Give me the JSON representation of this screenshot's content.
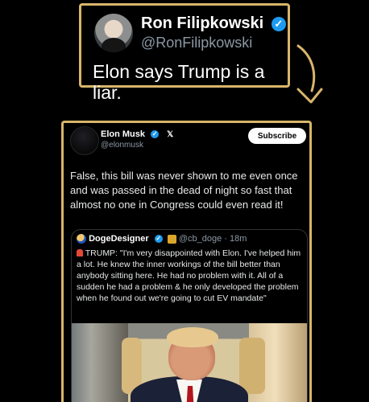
{
  "top_post": {
    "name": "Ron Filipkowski",
    "handle": "@RonFilipkowski",
    "text": "Elon says Trump is a liar.",
    "verified_icon": "verified-badge"
  },
  "main_post": {
    "name": "Elon Musk",
    "handle": "@elonmusk",
    "x_icon": "x-logo",
    "subscribe_label": "Subscribe",
    "text": "False, this bill was never shown to me even once and was passed in the dead of night so fast that almost no one in Congress could even read it!"
  },
  "quoted_post": {
    "name": "DogeDesigner",
    "handle": "@cb_doge",
    "separator": "·",
    "time": "18m",
    "text_prefix": "TRUMP: ",
    "text": "\"I'm very disappointed with Elon. I've helped him a lot. He knew the inner workings of the bill better than anybody sitting here. He had no problem with it. All of a sudden he had a problem & he only developed the problem when he found out we're going to cut EV mandate\""
  },
  "colors": {
    "gold_border": "#d8b56a",
    "verified_blue": "#1d9bf0",
    "muted_text": "#8b98a5"
  }
}
